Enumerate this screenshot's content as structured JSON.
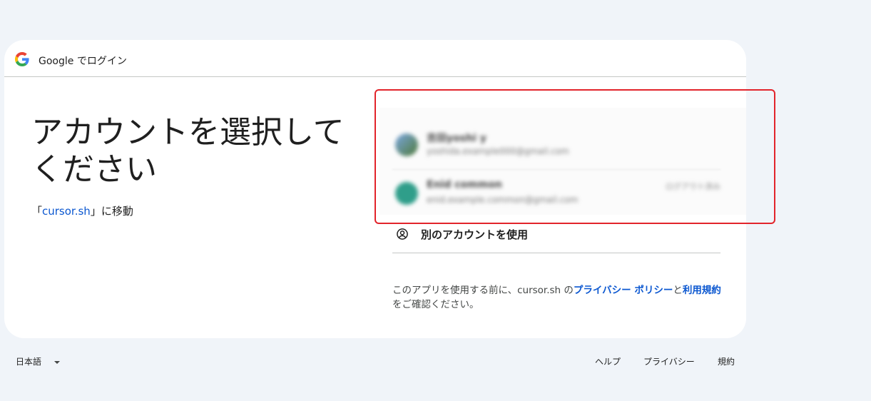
{
  "header": {
    "title": "Google でログイン"
  },
  "main": {
    "title": "アカウントを選択してください",
    "subtitle_prefix": "「",
    "subtitle_link": "cursor.sh",
    "subtitle_suffix": "」に移動"
  },
  "accounts": [
    {
      "name": "吉田yoshi y",
      "email": "yoshida.example000@gmail.com",
      "status": "",
      "avatar_color": "#6a8fc9"
    },
    {
      "name": "Enid common",
      "email": "enid.example.common@gmail.com",
      "status": "ログアウト済み",
      "avatar_color": "#2f9e8a"
    }
  ],
  "use_another": {
    "label": "別のアカウントを使用",
    "icon": "account-circle-icon"
  },
  "privacy": {
    "text_before": "このアプリを使用する前に、cursor.sh の",
    "privacy_link": "プライバシー ポリシー",
    "middle": "と",
    "terms_link": "利用規約",
    "text_after": "をご確認ください。"
  },
  "footer": {
    "language": "日本語",
    "help": "ヘルプ",
    "privacy": "プライバシー",
    "terms": "規約"
  },
  "colors": {
    "link": "#0b57d0",
    "highlight": "#e2242b",
    "background": "#f0f4f9"
  }
}
